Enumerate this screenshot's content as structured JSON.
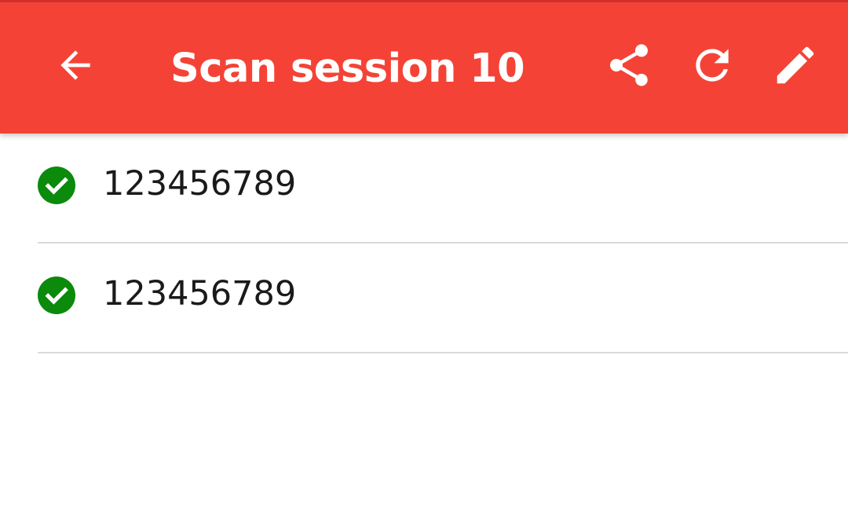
{
  "toolbar": {
    "title": "Scan session 10",
    "background_color": "#f44336",
    "icons": {
      "back": "arrow-back-icon",
      "share": "share-icon",
      "refresh": "refresh-icon",
      "edit": "pencil-icon"
    }
  },
  "scans": [
    {
      "value": "123456789",
      "status_icon": "check-circle-icon",
      "status_color": "#0b8a0b"
    },
    {
      "value": "123456789",
      "status_icon": "check-circle-icon",
      "status_color": "#0b8a0b"
    }
  ]
}
